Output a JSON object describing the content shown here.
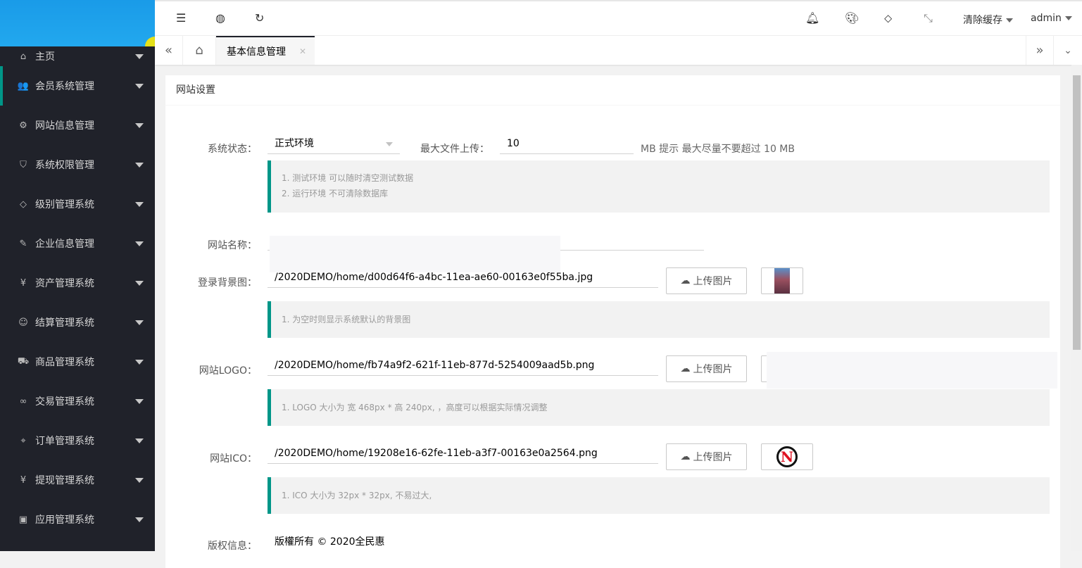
{
  "sidebar": {
    "items": [
      {
        "label": "主页",
        "icon": "home-icon",
        "g": "⌂"
      },
      {
        "label": "会员系统管理",
        "icon": "users-icon",
        "g": "👥"
      },
      {
        "label": "网站信息管理",
        "icon": "gear-icon",
        "g": "⚙"
      },
      {
        "label": "系统权限管理",
        "icon": "shield-icon",
        "g": "⛉"
      },
      {
        "label": "级别管理系统",
        "icon": "diamond-icon",
        "g": "◇"
      },
      {
        "label": "企业信息管理",
        "icon": "edit-icon",
        "g": "✎"
      },
      {
        "label": "资产管理系统",
        "icon": "yen-icon",
        "g": "¥"
      },
      {
        "label": "结算管理系统",
        "icon": "smile-icon",
        "g": "☺"
      },
      {
        "label": "商品管理系统",
        "icon": "cart-icon",
        "g": "⛟"
      },
      {
        "label": "交易管理系统",
        "icon": "link-icon",
        "g": "∞"
      },
      {
        "label": "订单管理系统",
        "icon": "location-icon",
        "g": "⌖"
      },
      {
        "label": "提现管理系统",
        "icon": "yen-icon",
        "g": "¥"
      },
      {
        "label": "应用管理系统",
        "icon": "app-icon",
        "g": "▣"
      }
    ]
  },
  "header": {
    "clear_cache": "清除缓存",
    "user": "admin"
  },
  "tabs": {
    "active": "基本信息管理"
  },
  "card": {
    "title": "网站设置"
  },
  "form": {
    "status_label": "系统状态：",
    "status_value": "正式环境",
    "max_label": "最大文件上传：",
    "max_value": "10",
    "max_hint": "MB 提示 最大尽量不要超过 10 MB",
    "status_tips": [
      "1. 测试环境 可以随时清空测试数据",
      "2. 运行环境 不可清除数据库"
    ],
    "name_label": "网站名称：",
    "bg_label": "登录背景图：",
    "bg_value": "/2020DEMO/home/d00d64f6-a4bc-11ea-ae60-00163e0f55ba.jpg",
    "bg_tip": "1. 为空时则显示系统默认的背景图",
    "logo_label": "网站LOGO：",
    "logo_value": "/2020DEMO/home/fb74a9f2-621f-11eb-877d-5254009aad5b.png",
    "logo_tip": "1. LOGO 大小为 宽 468px * 高 240px, ，高度可以根据实际情况调整",
    "ico_label": "网站ICO：",
    "ico_value": "/2020DEMO/home/19208e16-62fe-11eb-a3f7-00163e0a2564.png",
    "ico_tip": "1. ICO 大小为 32px * 32px, 不易过大,",
    "copy_label": "版权信息：",
    "copy_value": "版權所有 © 2020全民惠",
    "upload_label": "上传图片"
  },
  "colors": {
    "accent": "#009688",
    "sidebar": "#20222a"
  }
}
